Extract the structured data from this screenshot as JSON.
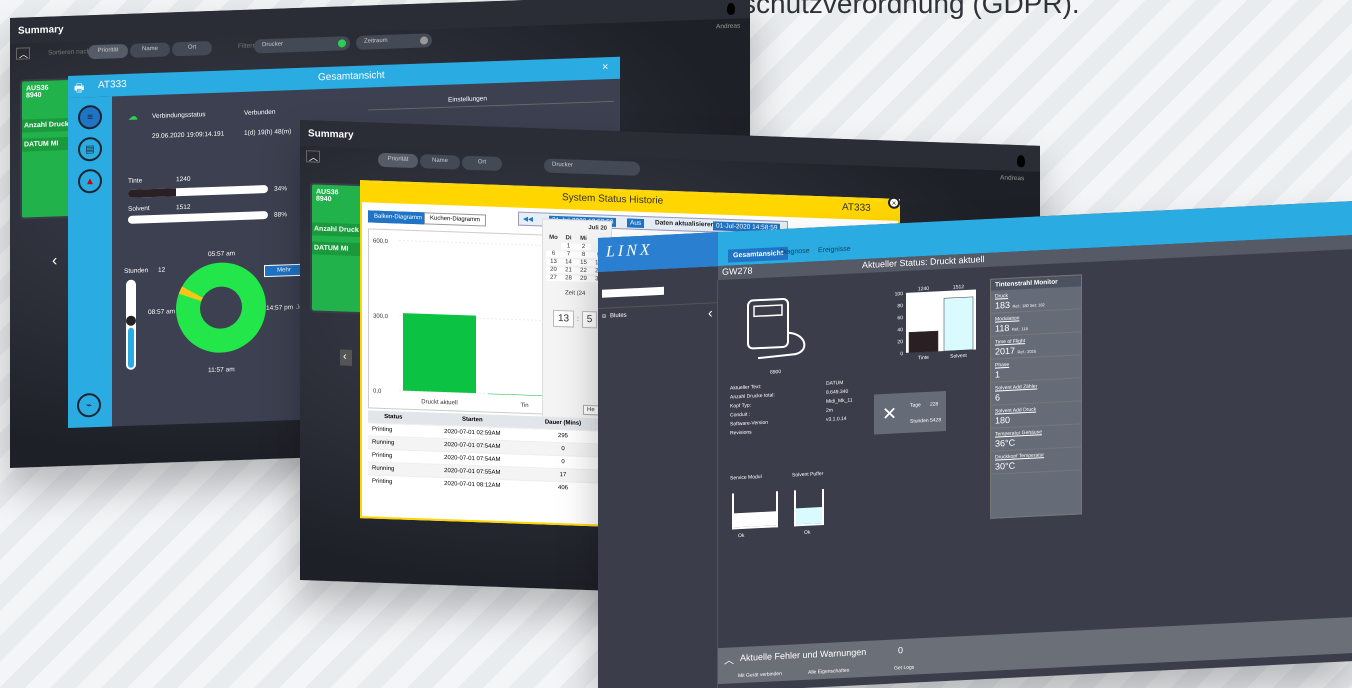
{
  "caption": "schutzverordnung (GDPR).",
  "screen1": {
    "app_title": "Summary",
    "sort_label": "Sortieren nach",
    "sort_options": [
      "Priorität",
      "Name",
      "Ort"
    ],
    "filter_label": "Filtern",
    "filter_value": "Drucker",
    "filter_value2": "Zeitraum",
    "user_label": "Andreas",
    "card": {
      "name": "AUS36",
      "count": "8940",
      "line1": "Anzahl Druck",
      "line2": "DATUM MI"
    },
    "modal": {
      "printer": "AT333",
      "title": "Gesamtansicht",
      "conn_label": "Verbindungsstatus",
      "conn_value": "Verbunden",
      "conn_time": "29.06.2020 19:09:14.191",
      "conn_duration": "1(d) 19(h) 48(m)",
      "settings_label": "Einstellungen",
      "ink_label": "Tinte",
      "ink_value": "1240",
      "ink_percent": "34%",
      "ink_fill": 0.34,
      "solvent_label": "Solvent",
      "solvent_value": "1512",
      "solvent_percent": "88%",
      "solvent_fill": 0.88,
      "hours_label": "Stunden",
      "hours_value": "12",
      "mode_button": "Mehr",
      "clock_top": "05:57 am",
      "clock_left": "08:57 am",
      "clock_right": "14:57 pm",
      "clock_bottom": "11:57 am",
      "clock_right_extra": "Jetzt"
    }
  },
  "screen2": {
    "app_title": "Summary",
    "sort_options": [
      "Priorität",
      "Name",
      "Ort"
    ],
    "filter_value": "Drucker",
    "user_label": "Andreas",
    "card": {
      "name": "AUS36",
      "count": "8940",
      "line1": "Anzahl Druck",
      "line2": "DATUM MI"
    },
    "modal": {
      "title": "System Status Historie",
      "printer": "AT333",
      "tab_bar": "Balken-Diagramm",
      "tab_pie": "Kuchen-Diagramm",
      "date_from": "31-Jul-2020 13:58:59",
      "apply": "Aus",
      "refresh": "Daten aktualisieren",
      "date_to": "01-Jul-2020 14:58:59",
      "cal_month": "Juli 20",
      "cal_days": [
        "Mo",
        "Di",
        "Mi"
      ],
      "cal_rows": [
        [
          "",
          "1",
          "2"
        ],
        [
          "6",
          "7",
          "8",
          "9"
        ],
        [
          "13",
          "14",
          "15",
          "16"
        ],
        [
          "20",
          "21",
          "22",
          "23"
        ],
        [
          "27",
          "28",
          "29",
          "30"
        ]
      ],
      "time_label": "Zeit (24",
      "hour": "13",
      "minute": "5",
      "today_btn": "He",
      "table_headers": [
        "Status",
        "Starten",
        "Dauer (Mins)"
      ],
      "table_rows": [
        [
          "Printing",
          "2020-07-01 02:59AM",
          "295"
        ],
        [
          "Running",
          "2020-07-01 07:54AM",
          "0"
        ],
        [
          "Printing",
          "2020-07-01 07:54AM",
          "0"
        ],
        [
          "Running",
          "2020-07-01 07:55AM",
          "17"
        ],
        [
          "Printing",
          "2020-07-01 08:12AM",
          "406"
        ]
      ]
    },
    "chart_data": {
      "type": "bar",
      "categories": [
        "Druckt aktuell",
        "Tin"
      ],
      "values": [
        310,
        0
      ],
      "ylim": [
        0,
        600
      ],
      "yticks": [
        "600,0",
        "300,0",
        "0,0"
      ],
      "colors": {
        "bar": "#0cc243"
      }
    }
  },
  "screen3": {
    "brand": "LINX",
    "nav": [
      "Gesamtansicht",
      "Diagnose",
      "Ereignisse"
    ],
    "sidebar_item": "Blutes",
    "printer_name": "GW278",
    "status_label": "Aktueller Status:",
    "status_value": "Druckt aktuell",
    "serial": "8900",
    "info_labels": [
      "Aktueller Text:",
      "Anzahl Drucke total:",
      "Kopf Typ:",
      "Conduit :",
      "Software-Version",
      "Revisions"
    ],
    "info_values": [
      "DATUM",
      "8.649.340",
      "Midi_Mk_11",
      "2m",
      "v3.1.0.14",
      ""
    ],
    "service_tage_label": "Tage",
    "service_tage": "228",
    "service_stunden_label": "Stunden",
    "service_stunden": "5428",
    "service_modul": "Service Modul",
    "solvent_puffer": "Solvent Puffer",
    "tank1_status": "Ok",
    "tank2_status": "Ok",
    "monitor": {
      "title": "Tintenstrahl Monitor",
      "items": [
        {
          "label": "Druck",
          "value": "183",
          "ref": "Ref.: 180  Set: 182"
        },
        {
          "label": "Modulation",
          "value": "118",
          "ref": "Ref.: 118"
        },
        {
          "label": "Time of Flight",
          "value": "2017",
          "ref": "Ref.: 2025"
        },
        {
          "label": "Phase",
          "value": "1",
          "ref": ""
        },
        {
          "label": "Solvent Add Zähler",
          "value": "6",
          "ref": ""
        },
        {
          "label": "Solvent Add Druck",
          "value": "180",
          "ref": ""
        },
        {
          "label": "Temperatur Gehäuse",
          "value": "36°C",
          "ref": ""
        },
        {
          "label": "Druckkopf Temperatur",
          "value": "30°C",
          "ref": ""
        }
      ]
    },
    "bottom_title": "Aktuelle Fehler und Warnungen",
    "bottom_count": "0",
    "bottom_actions": [
      "Mit Gerät verbinden",
      "Alle Eigenschaften",
      "Get Logs"
    ],
    "chart_data": {
      "type": "bar",
      "categories": [
        "Tinte",
        "Solvent"
      ],
      "top_labels": [
        "1240",
        "1512"
      ],
      "values": [
        34,
        88
      ],
      "ylim": [
        0,
        100
      ],
      "yticks": [
        "100",
        "80",
        "60",
        "40",
        "20",
        "0"
      ],
      "colors": {
        "ink": "#2a1f22",
        "solvent": "#d9fbff"
      }
    }
  }
}
